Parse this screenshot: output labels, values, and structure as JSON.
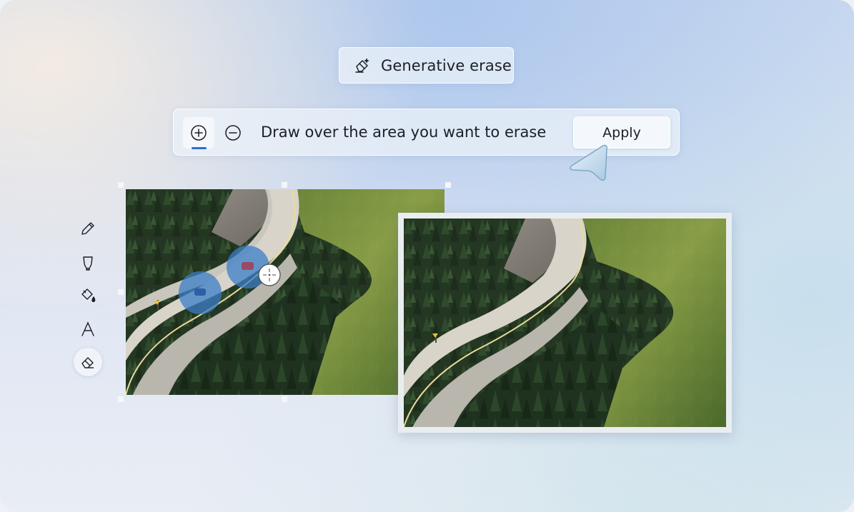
{
  "header": {
    "feature_title": "Generative erase",
    "feature_icon": "generative-erase-icon"
  },
  "toolbar": {
    "add_icon": "plus-circle-icon",
    "subtract_icon": "minus-circle-icon",
    "instruction": "Draw over the area you want to erase",
    "apply_label": "Apply",
    "active_mode": "add"
  },
  "side_tools": [
    {
      "icon": "pencil-icon",
      "active": false
    },
    {
      "icon": "highlighter-icon",
      "active": false
    },
    {
      "icon": "paint-bucket-icon",
      "active": false
    },
    {
      "icon": "text-icon",
      "active": false
    },
    {
      "icon": "eraser-icon",
      "active": true
    }
  ],
  "canvas": {
    "before_image": "mountain-road-forest-with-cars",
    "after_image": "mountain-road-forest-cars-erased"
  },
  "colors": {
    "accent": "#2a6fd1",
    "selection_blue": "#3c7fc8"
  }
}
